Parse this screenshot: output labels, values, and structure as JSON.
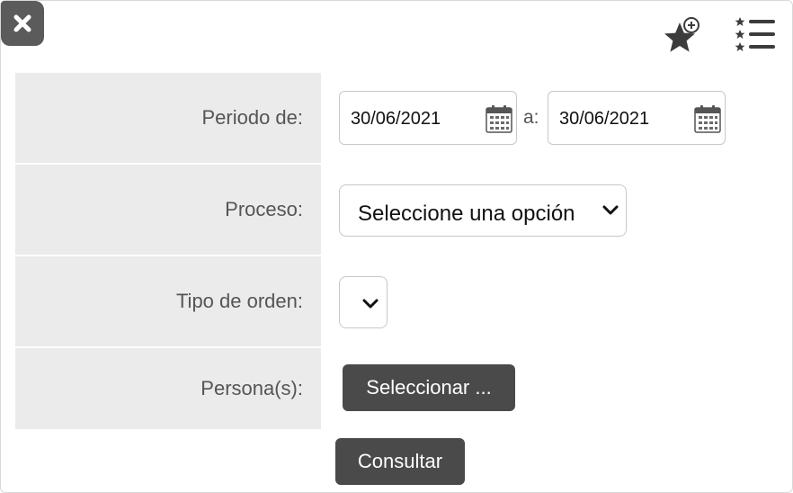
{
  "toolbar": {
    "close_icon": "close-icon",
    "favorite_icon": "star-add-icon",
    "list_icon": "starred-list-icon"
  },
  "form": {
    "period": {
      "label": "Periodo de:",
      "from_value": "30/06/2021",
      "separator": "a:",
      "to_value": "30/06/2021"
    },
    "process": {
      "label": "Proceso:",
      "selected": "Seleccione una opción"
    },
    "order_type": {
      "label": "Tipo de orden:",
      "selected": ""
    },
    "persons": {
      "label": "Persona(s):",
      "button_label": "Seleccionar ..."
    },
    "submit_label": "Consultar"
  },
  "colors": {
    "label_bg": "#ebebeb",
    "button_bg": "#4a4a4a",
    "label_text": "#555555"
  }
}
